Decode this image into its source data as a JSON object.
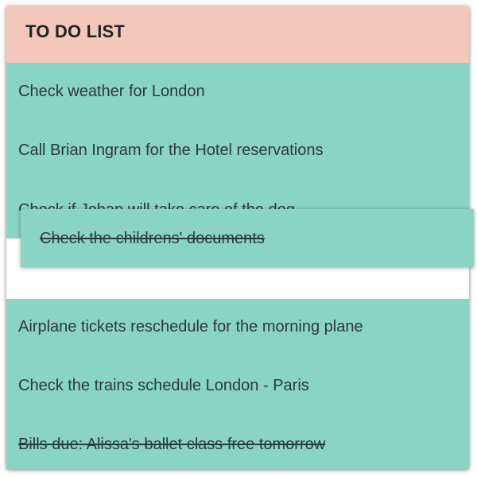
{
  "header": {
    "title": "TO DO LIST"
  },
  "items": [
    {
      "text": "Check weather for London",
      "done": false
    },
    {
      "text": "Call Brian Ingram for the Hotel reservations",
      "done": false
    },
    {
      "text": "Check if Johan will take care of the dog",
      "done": false
    },
    {
      "text": "Airplane tickets reschedule for the morning plane",
      "done": false
    },
    {
      "text": "Check the trains schedule London - Paris",
      "done": false
    },
    {
      "text": "Bills due: Alissa's ballet class free tomorrow",
      "done": true
    }
  ],
  "dragging_item": {
    "text": "Check the childrens' documents",
    "done": true
  },
  "colors": {
    "header_bg": "#f4c7bb",
    "item_bg": "#89d4c3",
    "drop_slot_bg": "#ffffff"
  }
}
